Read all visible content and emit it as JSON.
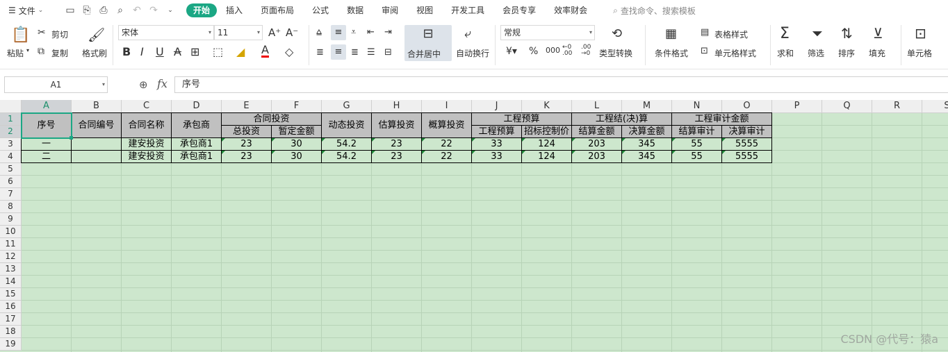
{
  "menu": {
    "file": "文件",
    "tabs": [
      "开始",
      "插入",
      "页面布局",
      "公式",
      "数据",
      "审阅",
      "视图",
      "开发工具",
      "会员专享",
      "效率财会"
    ],
    "search_placeholder": "查找命令、搜索模板"
  },
  "ribbon": {
    "paste": "粘贴",
    "cut": "剪切",
    "copy": "复制",
    "format_painter": "格式刷",
    "font_name": "宋体",
    "font_size": "11",
    "merge_center": "合并居中",
    "wrap_text": "自动换行",
    "number_format": "常规",
    "type_convert": "类型转换",
    "conditional_format": "条件格式",
    "table_style": "表格样式",
    "cell_style": "单元格样式",
    "sum": "求和",
    "filter": "筛选",
    "sort": "排序",
    "fill": "填充",
    "cells": "单元格"
  },
  "formula_bar": {
    "name_box": "A1",
    "fx": "fx",
    "content": "序号"
  },
  "columns": [
    "A",
    "B",
    "C",
    "D",
    "E",
    "F",
    "G",
    "H",
    "I",
    "J",
    "K",
    "L",
    "M",
    "N",
    "O",
    "P",
    "Q",
    "R",
    "S"
  ],
  "rows": [
    "1",
    "2",
    "3",
    "4",
    "5",
    "6",
    "7",
    "8",
    "9",
    "10",
    "11",
    "12",
    "13",
    "14",
    "15",
    "16",
    "17",
    "18",
    "19"
  ],
  "table": {
    "h_seq": "序号",
    "h_contract_no": "合同编号",
    "h_contract_name": "合同名称",
    "h_contractor": "承包商",
    "h_contract_invest": "合同投资",
    "h_total_invest": "总投资",
    "h_provisional": "暂定金额",
    "h_dynamic": "动态投资",
    "h_estimate": "估算投资",
    "h_budget_est": "概算投资",
    "h_project_budget": "工程预算",
    "h_project_budget_sub": "工程预算",
    "h_tender_limit": "招标控制价",
    "h_settlement_group": "工程结(决)算",
    "h_settlement_amt": "结算金额",
    "h_final_amt": "决算金额",
    "h_audit_group": "工程审计金额",
    "h_settle_audit": "结算审计",
    "h_final_audit": "决算审计",
    "data_rows": [
      [
        "一",
        "",
        "建安投资",
        "承包商1",
        "23",
        "30",
        "54.2",
        "23",
        "22",
        "33",
        "124",
        "203",
        "345",
        "55",
        "5555"
      ],
      [
        "二",
        "",
        "建安投资",
        "承包商1",
        "23",
        "30",
        "54.2",
        "23",
        "22",
        "33",
        "124",
        "203",
        "345",
        "55",
        "5555"
      ]
    ]
  },
  "watermark": "CSDN @代号：猿a"
}
